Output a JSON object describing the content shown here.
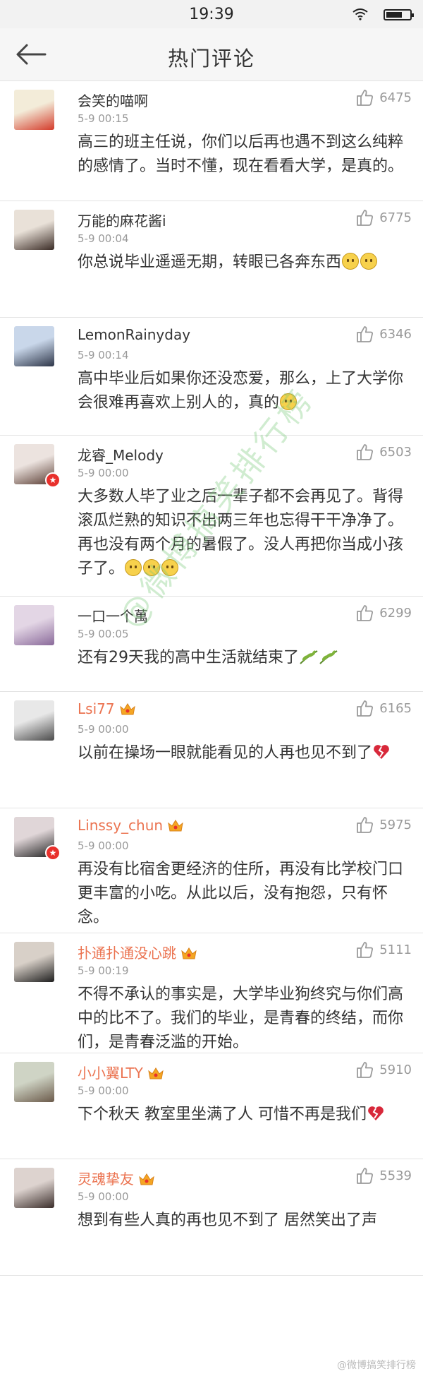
{
  "status_bar": {
    "time": "19:39"
  },
  "nav": {
    "title": "热门评论"
  },
  "comments": [
    {
      "user": "会笑的喵啊",
      "time": "5-9 00:15",
      "likes": "6475",
      "text": "高三的班主任说，你们以后再也遇不到这么纯粹的感情了。当时不懂，现在看看大学，是真的。",
      "emoji": []
    },
    {
      "user": "万能的麻花酱i",
      "time": "5-9 00:04",
      "likes": "6775",
      "text": "你总说毕业遥遥无期，转眼已各奔东西",
      "emoji": [
        "sad-face",
        "sad-face"
      ]
    },
    {
      "user": "LemonRainyday",
      "time": "5-9 00:14",
      "likes": "6346",
      "text": "高中毕业后如果你还没恋爱，那么，上了大学你会很难再喜欢上别人的，真的",
      "emoji": [
        "sad-face"
      ]
    },
    {
      "user": "龙睿_Melody",
      "time": "5-9 00:00",
      "likes": "6503",
      "text": "大多数人毕了业之后一辈子都不会再见了。背得滚瓜烂熟的知识不出两三年也忘得干干净净了。再也没有两个月的暑假了。没人再把你当成小孩子了。",
      "emoji": [
        "smile-face",
        "smile-face",
        "smile-face"
      ]
    },
    {
      "user": "一口一个萬",
      "time": "5-9 00:05",
      "likes": "6299",
      "text": "还有29天我的高中生活就结束了",
      "emoji": [
        "leaf",
        "leaf"
      ]
    },
    {
      "user": "Lsi77",
      "time": "5-9 00:00",
      "likes": "6165",
      "text": "以前在操场一眼就能看见的人再也见不到了",
      "emoji": [
        "broken-heart"
      ]
    },
    {
      "user": "Linssy_chun",
      "time": "5-9 00:00",
      "likes": "5975",
      "text": "再没有比宿舍更经济的住所，再没有比学校门口更丰富的小吃。从此以后，没有抱怨，只有怀念。",
      "emoji": []
    },
    {
      "user": "扑通扑通没心跳",
      "time": "5-9 00:19",
      "likes": "5111",
      "text": "不得不承认的事实是，大学毕业狗终究与你们高中的比不了。我们的毕业，是青春的终结，而你们，是青春泛滥的开始。",
      "emoji": []
    },
    {
      "user": "小小翼LTY",
      "time": "5-9 00:00",
      "likes": "5910",
      "text": "下个秋天 教室里坐满了人 可惜不再是我们",
      "emoji": [
        "broken-heart"
      ]
    },
    {
      "user": "灵魂挚友",
      "time": "5-9 00:00",
      "likes": "5539",
      "text": "想到有些人真的再也见不到了 居然笑出了声",
      "emoji": []
    }
  ],
  "watermark": "@微博搞笑排行榜",
  "corner_watermark": "@微博搞笑排行榜",
  "colors": {
    "vip_name": "#eb7350",
    "meta": "#999999",
    "text": "#333333",
    "badge": "#e8302c"
  }
}
